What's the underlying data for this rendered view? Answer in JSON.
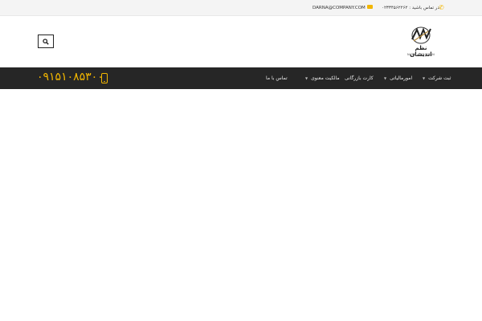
{
  "topbar": {
    "email": "DARNA@COMPANY.COM",
    "mail_icon": "mail-icon",
    "phone_text": "در تماس باشید : ۰۲۳۳۴۵۶۲۲۶۲",
    "phone_icon": "phone-icon"
  },
  "header": {
    "logo_fa": "نظم اندیشان",
    "logo_en": "NAZM ANDISHAN",
    "search_icon": "search-icon"
  },
  "nav": {
    "phone_number": "۰۹۱۵۱۰۸۵۳۰۰",
    "mobile_icon": "mobile-phone-icon",
    "items": [
      {
        "label": "ثبت شرکت",
        "has_dropdown": true
      },
      {
        "label": "امورمالیاتی",
        "has_dropdown": true
      },
      {
        "label": "کارت بازرگانی",
        "has_dropdown": false
      },
      {
        "label": "مالکیت معنوی",
        "has_dropdown": true
      },
      {
        "label": "تماس با ما",
        "has_dropdown": false
      }
    ]
  },
  "colors": {
    "accent": "#f2b600",
    "nav_bg": "#262626",
    "topbar_bg": "#f4f4f4"
  }
}
